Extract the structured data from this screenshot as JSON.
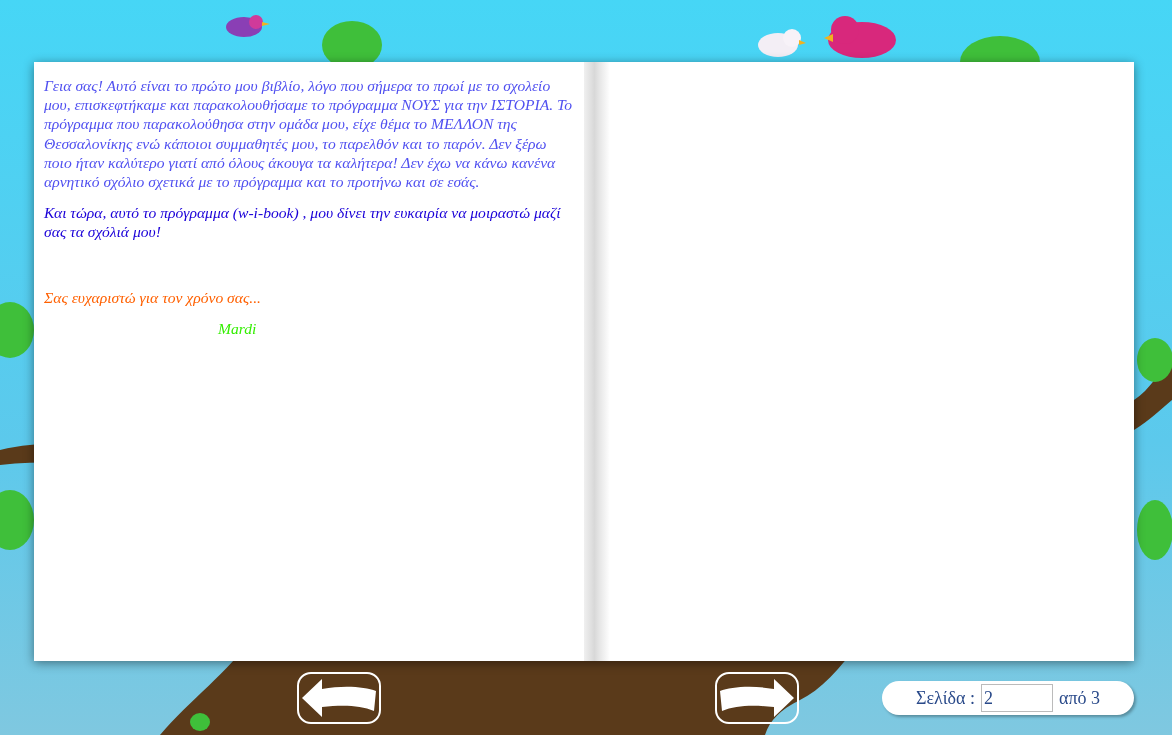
{
  "book": {
    "left_page": {
      "paragraphs": [
        {
          "text": "Γεια σας! Αυτό είναι το πρώτο μου βιβλίο, λόγο που σήμερα το πρωί με το σχολείο μου, επισκεφτήκαμε και παρακολουθήσαμε το πρόγραμμα ΝΟΥΣ για την ΙΣΤΟΡΙΑ. Το πρόγραμμα που παρακολούθησα στην ομάδα μου, είχε θέμα το ΜΕΛΛΟΝ της Θεσσαλονίκης ενώ κάποιοι συμμαθητές μου, το παρελθόν και το παρόν. Δεν ξέρω ποιο ήταν καλύτερο γιατί από όλους άκουγα τα καλήτερα! Δεν έχω να κάνω κανένα αρνητικό σχόλιο σχετικά με το πρόγραμμα και το προτήνω και σε εσάς.",
          "color": "#5050f0",
          "kind": "body"
        },
        {
          "text": "Και τώρα, αυτό το πρόγραμμα (w-i-book) , μου δίνει την ευκαιρία να μοιραστώ μαζί σας τα σχόλιά μου!",
          "color": "#1a00d8",
          "kind": "body"
        },
        {
          "text": "Σας ευχαριστώ για τον χρόνο σας...",
          "color": "#ff6000",
          "kind": "closing"
        },
        {
          "text": "Mardi",
          "color": "#33ee00",
          "kind": "signature"
        }
      ]
    }
  },
  "pager": {
    "label": "Σελίδα :",
    "value": "2",
    "total": "από 3"
  }
}
